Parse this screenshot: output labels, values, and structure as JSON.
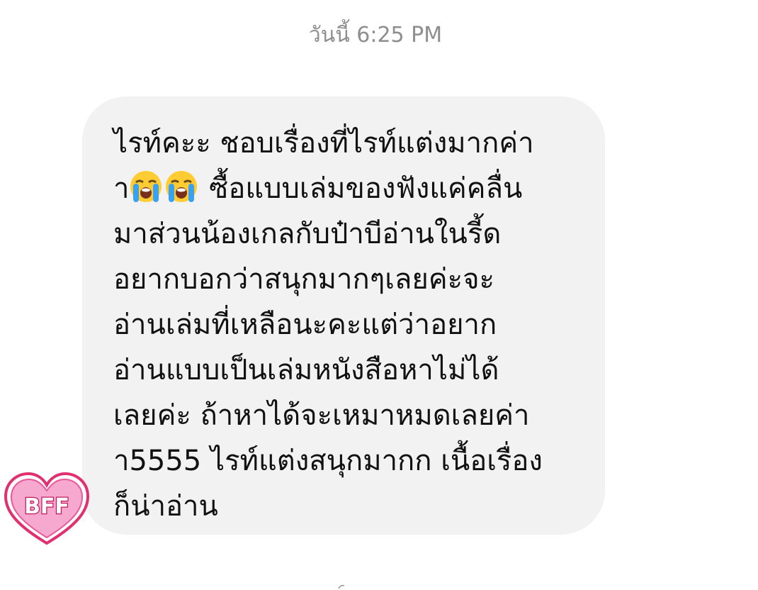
{
  "chat": {
    "timestamp": "วันนี้ 6:25 PM",
    "message": {
      "line1": "ไรท์คะะ ชอบเรื่องที่ไรท์แต่งมากค่า",
      "line2_prefix": "า",
      "line2_suffix": " ซื้อแบบเล่มของฟังแค่คลื่น",
      "line3": "มาส่วนน้องเกลกับป๋าบีอ่านในรี้ด",
      "line4": "อยากบอกว่าสนุกมากๆเลยค่ะจะ",
      "line5": "อ่านเล่มที่เหลือนะคะแต่ว่าอยาก",
      "line6": "อ่านแบบเป็นเล่มหนังสือหาไม่ได้",
      "line7": "เลยค่ะ ถ้าหาได้จะเหมาหมดเลยค่า",
      "line8": "า5555 ไรท์แต่งสนุกมากก เนื้อเรื่อง",
      "line9": "ก็น่าอ่าน",
      "emoji_icons": [
        "loudly-crying-face-icon",
        "loudly-crying-face-icon"
      ]
    },
    "avatar": {
      "label": "BFF",
      "icon": "heart-sticker-icon",
      "colors": {
        "fill": "#f7a8cf",
        "outline": "#e0306f",
        "text": "#ffffff"
      }
    },
    "colors": {
      "bubble": "#f2f2f2",
      "text": "#111111",
      "timestamp": "#8e8e8e"
    }
  }
}
